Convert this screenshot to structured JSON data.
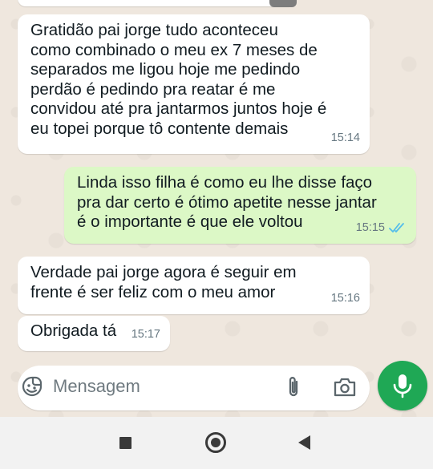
{
  "messages": [
    {
      "direction": "incoming",
      "text": "Gratidão pai jorge tudo aconteceu\ncomo combinado o meu ex 7 meses de\nseparados me ligou hoje me pedindo\nperdão é pedindo pra reatar é  me\nconvidou até pra jantarmos juntos hoje é\neu topei porque tô contente demais",
      "time": "15:14"
    },
    {
      "direction": "outgoing",
      "text": "Linda isso filha é como eu lhe disse faço\npra dar certo é ótimo apetite nesse jantar\né o importante é que ele voltou",
      "time": "15:15",
      "status": "read"
    },
    {
      "direction": "incoming",
      "text": "Verdade pai jorge agora é seguir em\nfrente é  ser feliz com o meu amor",
      "time": "15:16"
    },
    {
      "direction": "incoming",
      "text": "Obrigada tá",
      "time": "15:17"
    }
  ],
  "composer": {
    "placeholder": "Mensagem",
    "icons": [
      "sticker-emoji-icon",
      "paperclip-icon",
      "camera-icon"
    ],
    "send_icon": "microphone-icon"
  },
  "navigation": {
    "icons": [
      "recents-square-icon",
      "home-circle-icon",
      "back-triangle-icon"
    ]
  },
  "colors": {
    "chat_background": "#efe7de",
    "incoming_bubble": "#ffffff",
    "outgoing_bubble": "#dcf8c6",
    "accent_green": "#1fa855",
    "read_ticks": "#53bdeb"
  }
}
